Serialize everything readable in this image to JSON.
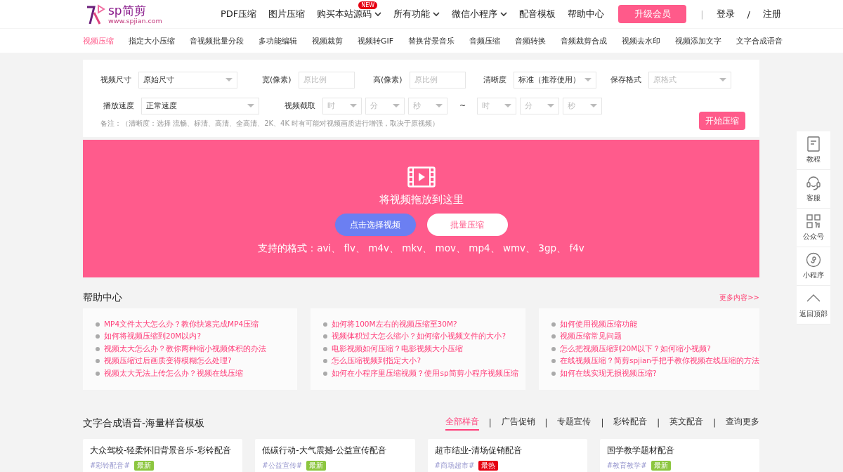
{
  "header": {
    "logo_title": "sp简剪",
    "logo_url": "www.spjian.com",
    "nav": [
      {
        "label": "PDF压缩",
        "dropdown": false
      },
      {
        "label": "图片压缩",
        "dropdown": false
      },
      {
        "label": "购买本站源码",
        "dropdown": true,
        "badge": "NEW"
      },
      {
        "label": "所有功能",
        "dropdown": true
      },
      {
        "label": "微信小程序",
        "dropdown": true
      },
      {
        "label": "配音模板",
        "dropdown": false
      },
      {
        "label": "帮助中心",
        "dropdown": false
      }
    ],
    "upgrade": "升级会员",
    "divider": "|",
    "login": "登录",
    "slash": "/",
    "register": "注册"
  },
  "subnav": [
    {
      "label": "视频压缩",
      "selected": true
    },
    {
      "label": "指定大小压缩",
      "selected": false
    },
    {
      "label": "音视频批量分段",
      "selected": false
    },
    {
      "label": "多功能编辑",
      "selected": false
    },
    {
      "label": "视频裁剪",
      "selected": false
    },
    {
      "label": "视频转GIF",
      "selected": false
    },
    {
      "label": "替换背景音乐",
      "selected": false
    },
    {
      "label": "音频压缩",
      "selected": false
    },
    {
      "label": "音频转换",
      "selected": false
    },
    {
      "label": "音频裁剪合成",
      "selected": false
    },
    {
      "label": "视频去水印",
      "selected": false
    },
    {
      "label": "视频添加文字",
      "selected": false
    },
    {
      "label": "文字合成语音",
      "selected": false
    }
  ],
  "settings": {
    "rows": [
      [
        {
          "label": "视频尺寸",
          "kind": "select",
          "value": "原始尺寸"
        },
        {
          "label": "宽(像素)",
          "kind": "input",
          "placeholder": "原比例"
        },
        {
          "label": "高(像素)",
          "kind": "input",
          "placeholder": "原比例"
        },
        {
          "label": "清晰度",
          "kind": "select",
          "value": "标准（推荐使用）"
        },
        {
          "label": "保存格式",
          "kind": "select",
          "placeholder": "原格式"
        }
      ],
      [
        {
          "label": "播放速度",
          "kind": "select",
          "value": "正常速度"
        },
        {
          "label": "视频截取",
          "kind": "range",
          "start": [
            "时",
            "分",
            "秒"
          ],
          "separator": "~",
          "end": [
            "时",
            "分",
            "秒"
          ]
        }
      ]
    ],
    "note": "备注：（清晰度：选择 流畅、标清、高清、全高清、2K、4K 时有可能对视频画质进行增强，取决于原视频）",
    "button": "开始压缩"
  },
  "dropzone": {
    "title": "将视频拖放到这里",
    "select_button": "点击选择视频",
    "batch_button": "批量压缩",
    "formats": "支持的格式：avi、 flv、 m4v、 mkv、 mov、 mp4、 wmv、 3gp、 f4v"
  },
  "help": {
    "title": "帮助中心",
    "more": "更多内容>>",
    "columns": [
      [
        "MP4文件太大怎么办？教你快速完成MP4压缩",
        "如何将视频压缩到20M以内?",
        "视频太大怎么办？教你两种缩小视频体积的办法",
        "视频压缩过后画质变得模糊怎么处理?",
        "视频太大无法上传怎么办？视频在线压缩"
      ],
      [
        "如何将100M左右的视频压缩至30M?",
        "视频体积过大怎么缩小？如何缩小视频文件的大小?",
        "电影视频如何压缩？电影视频大小压缩",
        "怎么压缩视频到指定大小?",
        "如何在小程序里压缩视频？使用sp简剪小程序视频压缩"
      ],
      [
        "如何使用视频压缩功能",
        "视频压缩常见问题",
        "怎么把视频压缩到20M以下？如何缩小视频?",
        "在线视频压缩？简剪spjian手把手教你视频在线压缩的方法",
        "如何在线实现无损视频压缩?"
      ]
    ]
  },
  "tts": {
    "title": "文字合成语音-海量样音模板",
    "divider": "|",
    "tabs": [
      {
        "label": "全部样音",
        "selected": true
      },
      {
        "label": "广告促销",
        "selected": false
      },
      {
        "label": "专题宣传",
        "selected": false
      },
      {
        "label": "彩铃配音",
        "selected": false
      },
      {
        "label": "英文配音",
        "selected": false
      },
      {
        "label": "查询更多",
        "selected": false
      }
    ],
    "cards": [
      {
        "title": "大众驾校-轻柔怀旧背景音乐-彩铃配音",
        "tag": "#彩铃配音#",
        "badge": "最新",
        "color": "#8cc63f"
      },
      {
        "title": "低碳行动-大气震撼-公益宣传配音",
        "tag": "#公益宣传#",
        "badge": "最新",
        "color": "#8cc63f"
      },
      {
        "title": "超市结业-清场促销配音",
        "tag": "#商场超市#",
        "badge": "最热",
        "color": "#e60012"
      },
      {
        "title": "国学教学题材配音",
        "tag": "#教育教学#",
        "badge": "最新",
        "color": "#8cc63f"
      }
    ]
  },
  "sidebar": [
    {
      "label": "教程",
      "kind": "book"
    },
    {
      "label": "客服",
      "kind": "headset"
    },
    {
      "label": "公众号",
      "kind": "qr"
    },
    {
      "label": "小程序",
      "kind": "mini"
    },
    {
      "label": "返回顶部",
      "kind": "top"
    }
  ]
}
